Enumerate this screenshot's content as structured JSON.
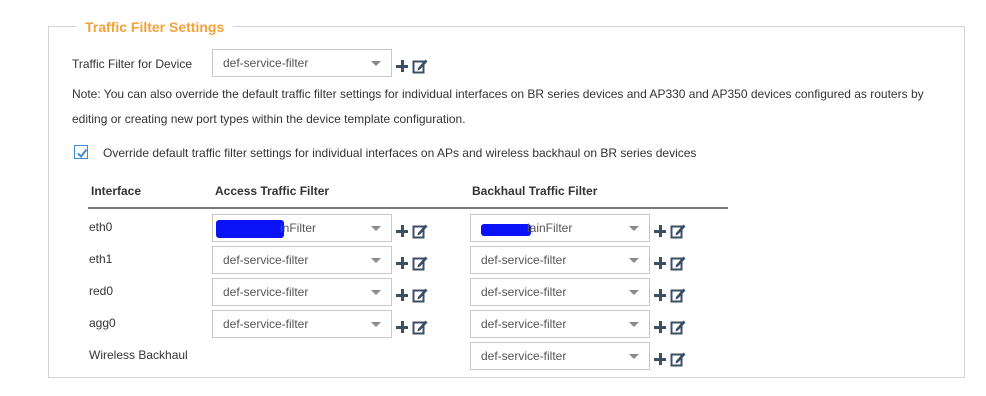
{
  "section": {
    "title": "Traffic Filter Settings"
  },
  "device_filter": {
    "label": "Traffic Filter for Device",
    "value": "def-service-filter"
  },
  "note": {
    "line1": "Note: You can also override the default traffic filter settings for individual interfaces on BR series devices and AP330 and AP350 devices configured as routers by",
    "line2": "editing or creating new port types within the device template configuration."
  },
  "override": {
    "checked": true,
    "label": "Override default traffic filter settings for individual interfaces on APs and wireless backhaul on BR series devices"
  },
  "table": {
    "headers": {
      "interface": "Interface",
      "access": "Access Traffic Filter",
      "backhaul": "Backhaul Traffic Filter"
    },
    "rows": [
      {
        "interface": "eth0",
        "access": "inFilter",
        "backhaul": "lainFilter"
      },
      {
        "interface": "eth1",
        "access": "def-service-filter",
        "backhaul": "def-service-filter"
      },
      {
        "interface": "red0",
        "access": "def-service-filter",
        "backhaul": "def-service-filter"
      },
      {
        "interface": "agg0",
        "access": "def-service-filter",
        "backhaul": "def-service-filter"
      },
      {
        "interface": "Wireless Backhaul",
        "backhaul": "def-service-filter"
      }
    ]
  },
  "icons": {
    "add": "plus-icon",
    "edit": "edit-icon",
    "check": "checkmark-icon"
  },
  "colors": {
    "title": "#f3a13a",
    "icon": "#3b4f64",
    "checkbox": "#3d8bd6"
  }
}
